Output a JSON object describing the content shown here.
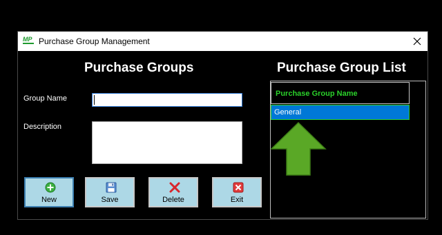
{
  "window": {
    "title": "Purchase Group Management",
    "icon_text": "MP"
  },
  "form": {
    "heading": "Purchase Groups",
    "group_name_label": "Group Name",
    "group_name_value": "",
    "description_label": "Description",
    "description_value": ""
  },
  "buttons": {
    "new_label": "New",
    "save_label": "Save",
    "delete_label": "Delete",
    "exit_label": "Exit"
  },
  "list": {
    "heading": "Purchase Group List",
    "column_header": "Purchase Group Name",
    "rows": [
      "General"
    ]
  },
  "colors": {
    "background": "#000000",
    "header_text": "#2ad02a",
    "selection": "#0078d7",
    "button_face": "#add8e6",
    "arrow": "#5aa826"
  },
  "icons": {
    "app": "app-logo-icon",
    "close": "close-icon",
    "new": "plus-circle-icon",
    "save": "floppy-disk-icon",
    "delete": "red-x-icon",
    "exit": "exit-icon",
    "arrow": "up-arrow-icon"
  }
}
